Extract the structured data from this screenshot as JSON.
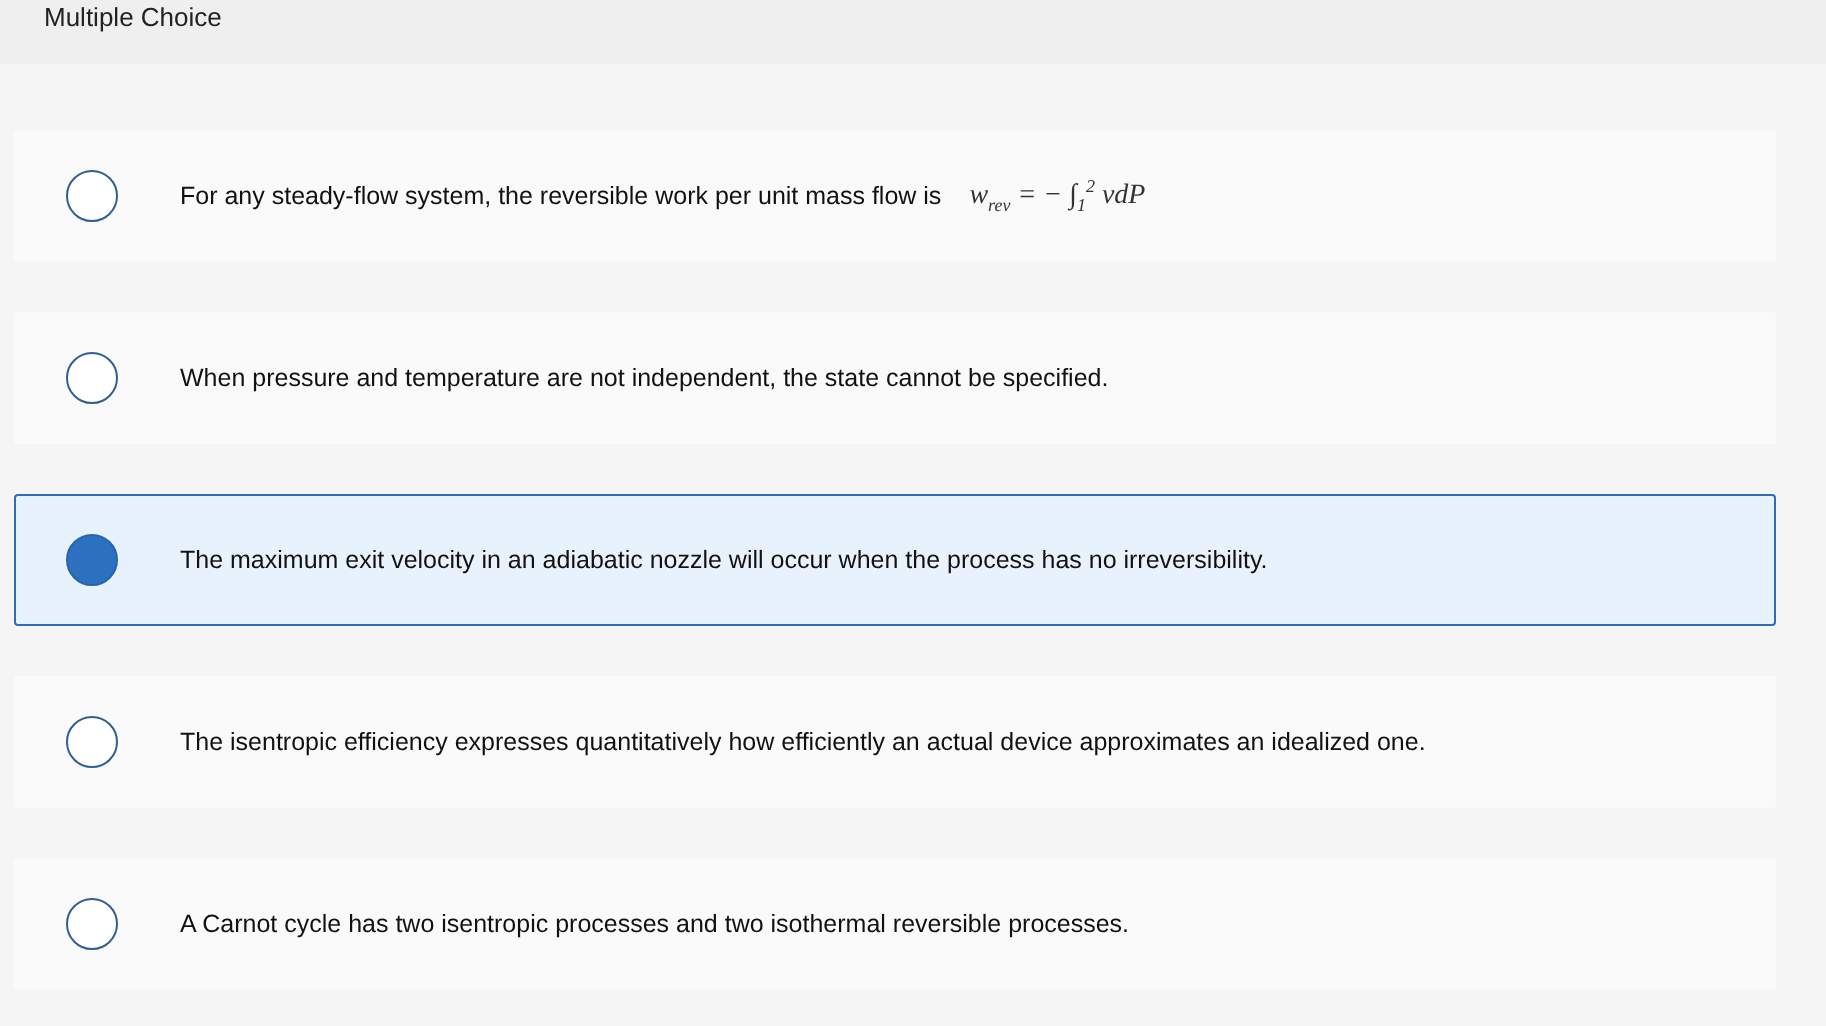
{
  "header": {
    "title": "Multiple Choice"
  },
  "options": [
    {
      "text": "For any steady-flow system, the reversible work per unit mass flow is",
      "formula": "w$_{rev}$ = − ∫$_{1}$$^{2}$ vdP",
      "selected": false
    },
    {
      "text": "When pressure and temperature are not independent, the state cannot be specified.",
      "selected": false
    },
    {
      "text": "The maximum exit velocity in an adiabatic nozzle will occur when the process has no irreversibility.",
      "selected": true
    },
    {
      "text": "The isentropic efficiency expresses quantitatively how efficiently an actual device approximates an idealized one.",
      "selected": false
    },
    {
      "text": "A Carnot cycle has two isentropic processes and two isothermal reversible processes.",
      "selected": false
    }
  ]
}
